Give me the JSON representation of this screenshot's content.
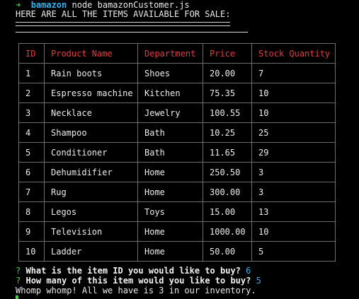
{
  "terminal": {
    "prompt_arrow": "➜",
    "prompt_dir": "bamazon",
    "command": " node bamazonCustomer.js",
    "heading": "HERE ARE ALL THE ITEMS AVAILABLE FOR SALE:"
  },
  "table": {
    "headers": [
      "ID",
      "Product Name",
      "Department",
      "Price",
      "Stock Quantity"
    ],
    "rows": [
      [
        "1",
        "Rain boots",
        "Shoes",
        "20.00",
        "7"
      ],
      [
        "2",
        "Espresso machine",
        "Kitchen",
        "75.35",
        "10"
      ],
      [
        "3",
        "Necklace",
        "Jewelry",
        "100.55",
        "10"
      ],
      [
        "4",
        "Shampoo",
        "Bath",
        "10.25",
        "25"
      ],
      [
        "5",
        "Conditioner",
        "Bath",
        "11.65",
        "29"
      ],
      [
        "6",
        "Dehumidifier",
        "Home",
        "250.50",
        "3"
      ],
      [
        "7",
        "Rug",
        "Home",
        "300.00",
        "3"
      ],
      [
        "8",
        "Legos",
        "Toys",
        "15.00",
        "13"
      ],
      [
        "9",
        "Television",
        "Home",
        "1000.00",
        "10"
      ],
      [
        "10",
        "Ladder",
        "Home",
        "50.00",
        "5"
      ]
    ]
  },
  "questions": [
    {
      "mark": "?",
      "text": "What is the item ID you would like to buy?",
      "answer": "6"
    },
    {
      "mark": "?",
      "text": "How many of this item would you like to buy?",
      "answer": "5"
    }
  ],
  "result_message": "Whomp whomp! All we have is 3 in our inventory.",
  "colors": {
    "background": "#000000",
    "header_text": "#e33b3b",
    "prompt_arrow": "#4ad04a",
    "prompt_dir": "#2fb4f0",
    "answer": "#2fb4f0",
    "table_border": "#6d6d6d"
  }
}
